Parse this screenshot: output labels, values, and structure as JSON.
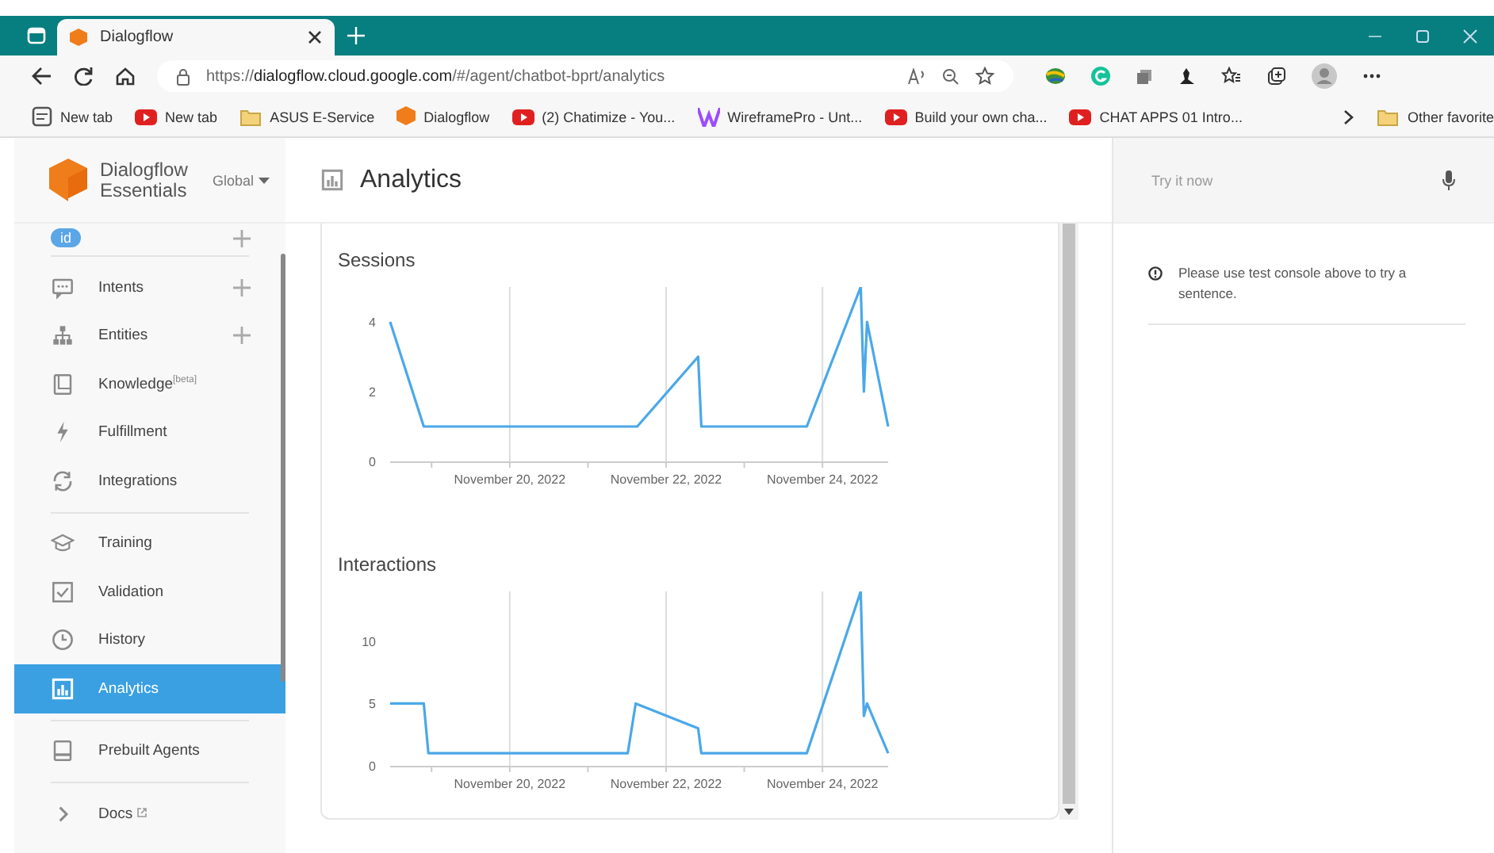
{
  "browser": {
    "tab": {
      "title": "Dialogflow",
      "selected": true
    },
    "url": "https://**dialogflow.cloud.google.com**/#/agent/chatbot-bprt/analytics",
    "bookmarks": [
      {
        "label": "New tab",
        "kind": "page"
      },
      {
        "label": "New tab",
        "kind": "video"
      },
      {
        "label": "ASUS E-Service",
        "kind": "folder"
      },
      {
        "label": "Dialogflow",
        "kind": "cube"
      },
      {
        "label": "(2) Chatimize - You...",
        "kind": "video"
      },
      {
        "label": "WireframePro - Unt...",
        "kind": "wireframe"
      },
      {
        "label": "Build your own cha...",
        "kind": "video"
      },
      {
        "label": "CHAT APPS 01 Intro...",
        "kind": "video"
      }
    ],
    "other_favorites": "Other favorite"
  },
  "sidebar": {
    "brand": [
      "Dialogflow",
      "Essentials"
    ],
    "region": "Global",
    "agent": "id",
    "sections": [
      [
        {
          "label": "Intents",
          "kind": "chat",
          "add": true,
          "selected": false
        },
        {
          "label": "Entities",
          "kind": "tree",
          "add": true,
          "selected": false
        },
        {
          "label": "Knowledge$^{[beta]}$",
          "kind": "book",
          "add": false,
          "selected": false
        },
        {
          "label": "Fulfillment",
          "kind": "bolt",
          "add": false,
          "selected": false
        },
        {
          "label": "Integrations",
          "kind": "sync",
          "add": false,
          "selected": false
        }
      ],
      [
        {
          "label": "Training",
          "kind": "cap",
          "add": false,
          "selected": false
        },
        {
          "label": "Validation",
          "kind": "check",
          "add": false,
          "selected": false
        },
        {
          "label": "History",
          "kind": "clock",
          "add": false,
          "selected": false
        },
        {
          "label": "Analytics",
          "kind": "chart",
          "add": false,
          "selected": true
        }
      ],
      [
        {
          "label": "Prebuilt Agents",
          "kind": "agent",
          "add": false,
          "selected": false
        }
      ],
      [
        {
          "label": "Docs",
          "kind": "chevron",
          "add": false,
          "selected": false,
          "external": true
        }
      ]
    ]
  },
  "main": {
    "title": "Analytics",
    "charts": [
      {
        "chart_data": {
          "type": "line",
          "title": "Sessions",
          "x": [
            "2022-11-18T11:17",
            "2022-11-18T21:36",
            "2022-11-21T15:07",
            "2022-11-22T09:50",
            "2022-11-22T10:48",
            "2022-11-23T19:12",
            "2022-11-24T11:46",
            "2022-11-24T12:43",
            "2022-11-24T13:41",
            "2022-11-24T20:10"
          ],
          "series": [
            {
              "color": "#4aa8e8",
              "values": [
                4,
                1,
                1,
                3,
                1,
                1,
                5,
                2,
                4,
                1
              ]
            }
          ],
          "xlim": [
            "2022-11-18T11:17",
            "2022-11-24T20:10"
          ],
          "ylim": [
            0,
            5
          ],
          "grid": "x",
          "xticks": [
            {
              "value": "2022-11-20",
              "label": "November 20, 2022"
            },
            {
              "value": "2022-11-22",
              "label": "November 22, 2022"
            },
            {
              "value": "2022-11-24",
              "label": "November 24, 2022"
            }
          ],
          "yticks": [
            0,
            2,
            4
          ]
        }
      },
      {
        "chart_data": {
          "type": "line",
          "title": "Interactions",
          "x": [
            "2022-11-18T11:17",
            "2022-11-18T21:36",
            "2022-11-18T23:02",
            "2022-11-21T12:14",
            "2022-11-21T14:38",
            "2022-11-22T09:50",
            "2022-11-22T10:48",
            "2022-11-23T19:12",
            "2022-11-24T11:46",
            "2022-11-24T12:43",
            "2022-11-24T13:41",
            "2022-11-24T20:10"
          ],
          "series": [
            {
              "color": "#4aa8e8",
              "values": [
                5,
                5,
                1,
                1,
                5,
                3,
                1,
                1,
                14,
                4,
                5,
                1
              ]
            }
          ],
          "xlim": [
            "2022-11-18T11:17",
            "2022-11-24T20:10"
          ],
          "ylim": [
            0,
            14
          ],
          "grid": "x",
          "xticks": [
            {
              "value": "2022-11-20",
              "label": "November 20, 2022"
            },
            {
              "value": "2022-11-22",
              "label": "November 22, 2022"
            },
            {
              "value": "2022-11-24",
              "label": "November 24, 2022"
            }
          ],
          "yticks": [
            0,
            5,
            10
          ]
        }
      }
    ]
  },
  "console": {
    "placeholder": "Try it now",
    "message": "Please use test console above to try a sentence."
  }
}
